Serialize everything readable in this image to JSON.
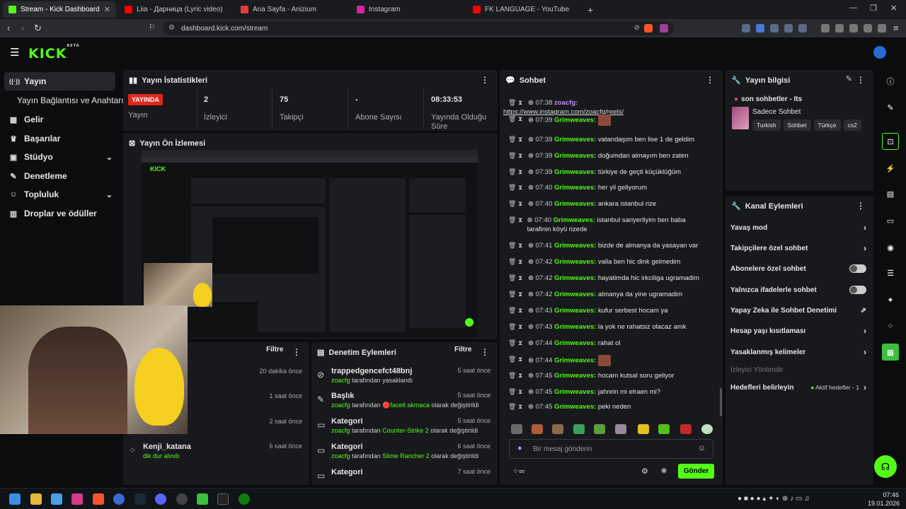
{
  "browser": {
    "tabs": [
      {
        "label": "Stream - Kick Dashboard",
        "active": true,
        "color": "#53fc18"
      },
      {
        "label": "Liia - Дарница (Lyric video) - You",
        "active": false,
        "color": "#ff0000"
      },
      {
        "label": "Ana Sayfa - Anizium",
        "active": false,
        "color": "#e63a3a"
      },
      {
        "label": "Instagram",
        "active": false,
        "color": "#d6249f"
      },
      {
        "label": "FK LANGUAGE - YouTube",
        "active": false,
        "color": "#ff0000"
      }
    ],
    "new_tab": "+",
    "url": "dashboard.kick.com/stream"
  },
  "app": {
    "logo": "KICK",
    "logo_sup": "BETA"
  },
  "sidebar": {
    "items": [
      {
        "label": "Yayın",
        "icon": "signal-icon",
        "glyph": "((·))",
        "active": true
      },
      {
        "label": "Yayın Bağlantısı ve Anahtarı",
        "icon": "",
        "glyph": "",
        "active": false
      },
      {
        "label": "Gelir",
        "icon": "chart-icon",
        "glyph": "▦",
        "active": false
      },
      {
        "label": "Başarılar",
        "icon": "trophy-icon",
        "glyph": "🏆",
        "active": false
      },
      {
        "label": "Stüdyo",
        "icon": "studio-icon",
        "glyph": "▣",
        "active": false,
        "chevron": "⌄"
      },
      {
        "label": "Denetleme",
        "icon": "wrench-icon",
        "glyph": "🔧",
        "active": false
      },
      {
        "label": "Topluluk",
        "icon": "community-icon",
        "glyph": "👥",
        "active": false,
        "chevron": "⌄"
      },
      {
        "label": "Droplar ve ödüller",
        "icon": "drops-icon",
        "glyph": "▥",
        "active": false
      }
    ]
  },
  "stats": {
    "title": "Yayın İstatistikleri",
    "live_badge": "YAYINDA",
    "live_label": "Yayın",
    "viewers": {
      "value": "2",
      "label": "İzleyici"
    },
    "followers": {
      "value": "75",
      "label": "Takipçi"
    },
    "subs": {
      "value": "-",
      "label": "Abone Sayısı"
    },
    "duration": {
      "value": "08:33:53",
      "label": "Yayında Olduğu Süre"
    }
  },
  "preview": {
    "title": "Yayın Ön İzlemesi"
  },
  "activity_left": {
    "filter": "Filtre",
    "rows": [
      {
        "time": "20 dakika önce"
      },
      {
        "time": "1 saat önce"
      },
      {
        "time": "2 saat önce"
      },
      {
        "title": "Kenji_katana",
        "desc": "dik dur alındı",
        "time": "6 saat önce"
      }
    ]
  },
  "mod_actions": {
    "title": "Denetim Eylemleri",
    "filter": "Filtre",
    "rows": [
      {
        "title": "trappedgencefct48bnj",
        "user": "zoacfg",
        "desc": "tarafından yasaklandı",
        "time": "5 saat önce"
      },
      {
        "title": "Başlık",
        "user": "zoacfg",
        "desc_pre": "tarafından",
        "value": "🔴faceit akmaca",
        "desc": "olarak değiştirildi",
        "time": "5 saat önce"
      },
      {
        "title": "Kategori",
        "user": "zoacfg",
        "desc_pre": "tarafından",
        "value": "Counter-Strike 2",
        "desc": "olarak değiştirildi",
        "time": "5 saat önce"
      },
      {
        "title": "Kategori",
        "user": "zoacfg",
        "desc_pre": "tarafından",
        "value": "Slime Rancher 2",
        "desc": "olarak değiştirildi",
        "time": "6 saat önce"
      },
      {
        "title": "Kategori",
        "time": "7 saat önce"
      }
    ]
  },
  "chat": {
    "title": "Sohbet",
    "messages": [
      {
        "time": "07:38",
        "user": "zoacfg:",
        "text": "https://www.instagram.com/zoacfg/reels/",
        "purple": true
      },
      {
        "time": "07:39",
        "user": "Grimweaves:",
        "text": "",
        "emote": true
      },
      {
        "time": "07:39",
        "user": "Grimweaves:",
        "text": "vatandaşım ben lise 1 de geldim"
      },
      {
        "time": "07:39",
        "user": "Grimweaves:",
        "text": "doğumdan almayım ben zaten"
      },
      {
        "time": "07:39",
        "user": "Grimweaves:",
        "text": "türkiye de geçti küçüklüğüm"
      },
      {
        "time": "07:40",
        "user": "Grimweaves:",
        "text": "her yil geliyorum"
      },
      {
        "time": "07:40",
        "user": "Grimweaves:",
        "text": "ankara istanbul rize"
      },
      {
        "time": "07:40",
        "user": "Grimweaves:",
        "text": "istanbul sariyerliyim ben baba tarafinin köyü rizede"
      },
      {
        "time": "07:41",
        "user": "Grimweaves:",
        "text": "bizde de almanya da yasayan var"
      },
      {
        "time": "07:42",
        "user": "Grimweaves:",
        "text": "valla ben hic dink gelmedim"
      },
      {
        "time": "07:42",
        "user": "Grimweaves:",
        "text": "hayatimda hic irkciliga ugramadim"
      },
      {
        "time": "07:42",
        "user": "Grimweaves:",
        "text": "almanya da yine ugramadim"
      },
      {
        "time": "07:43",
        "user": "Grimweaves:",
        "text": "kufur serbest hocam ya"
      },
      {
        "time": "07:43",
        "user": "Grimweaves:",
        "text": "la yok ne rahatsiz olacaz amk"
      },
      {
        "time": "07:44",
        "user": "Grimweaves:",
        "text": "rahat ol"
      },
      {
        "time": "07:44",
        "user": "Grimweaves:",
        "text": "",
        "emote": true
      },
      {
        "time": "07:45",
        "user": "Grimweaves:",
        "text": "hocam kutsal soru geliyor"
      },
      {
        "time": "07:45",
        "user": "Grimweaves:",
        "text": "jahrein mi elraen mi?"
      },
      {
        "time": "07:45",
        "user": "Grimweaves:",
        "text": "peki neden"
      }
    ],
    "input_placeholder": "Bir mesaj gönderin",
    "send_label": "Gönder"
  },
  "stream_info": {
    "title": "Yayın bilgisi",
    "stream_title": "son sohbetler - Its",
    "category": "Sadece Sohbet",
    "tags": [
      "Turkish",
      "Sohbet",
      "Türkçe",
      "cs2"
    ]
  },
  "channel_actions": {
    "title": "Kanal Eylemleri",
    "rows": [
      {
        "label": "Yavaş mod",
        "kind": "chevron"
      },
      {
        "label": "Takipçilere özel sohbet",
        "kind": "chevron"
      },
      {
        "label": "Abonelere özel sohbet",
        "kind": "toggle"
      },
      {
        "label": "Yalnızca ifadelerle sohbet",
        "kind": "toggle"
      },
      {
        "label": "Yapay Zeka ile Sohbet Denetimi",
        "kind": "external"
      },
      {
        "label": "Hesap yaşı kısıtlaması",
        "kind": "chevron"
      },
      {
        "label": "Yasaklanmış kelimeler",
        "kind": "chevron"
      },
      {
        "label": "İzleyici Yönlendir",
        "kind": "disabled"
      },
      {
        "label": "Hedefleri belirleyin",
        "kind": "chevron",
        "badge": "Aktif hedefler - 1"
      }
    ]
  },
  "taskbar": {
    "time": "07:46",
    "date": "19.01.2026"
  },
  "colors": {
    "accent": "#53fc18",
    "live": "#e1261c"
  }
}
